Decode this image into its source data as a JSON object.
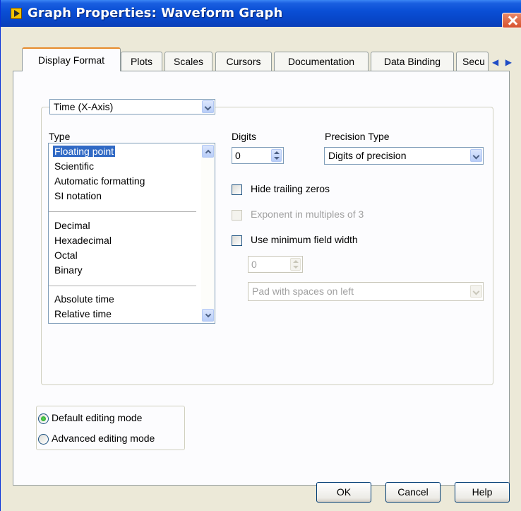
{
  "window": {
    "title": "Graph Properties: Waveform Graph"
  },
  "tabs": [
    {
      "label": "Display Format"
    },
    {
      "label": "Plots"
    },
    {
      "label": "Scales"
    },
    {
      "label": "Cursors"
    },
    {
      "label": "Documentation"
    },
    {
      "label": "Data Binding"
    },
    {
      "label": "Secu"
    }
  ],
  "tab_scroll": {
    "left": "◀",
    "right": "▶"
  },
  "axis_select": {
    "value": "Time (X-Axis)"
  },
  "type_section": {
    "label": "Type",
    "groups": [
      [
        "Floating point",
        "Scientific",
        "Automatic formatting",
        "SI notation"
      ],
      [
        "Decimal",
        "Hexadecimal",
        "Octal",
        "Binary"
      ],
      [
        "Absolute time",
        "Relative time"
      ]
    ],
    "selected": "Floating point"
  },
  "digits": {
    "label": "Digits",
    "value": "0"
  },
  "precision_type": {
    "label": "Precision Type",
    "value": "Digits of precision"
  },
  "options": {
    "hide_trailing_zeros": {
      "label": "Hide trailing zeros",
      "checked": false,
      "enabled": true
    },
    "exponent_multiples": {
      "label": "Exponent in multiples of 3",
      "checked": false,
      "enabled": false
    },
    "use_min_field_width": {
      "label": "Use minimum field width",
      "checked": false,
      "enabled": true
    }
  },
  "field_width": {
    "value": "0"
  },
  "padding": {
    "value": "Pad with spaces on left"
  },
  "editing_mode": {
    "default_label": "Default editing mode",
    "advanced_label": "Advanced editing mode",
    "selected": "default"
  },
  "buttons": {
    "ok": "OK",
    "cancel": "Cancel",
    "help": "Help"
  }
}
